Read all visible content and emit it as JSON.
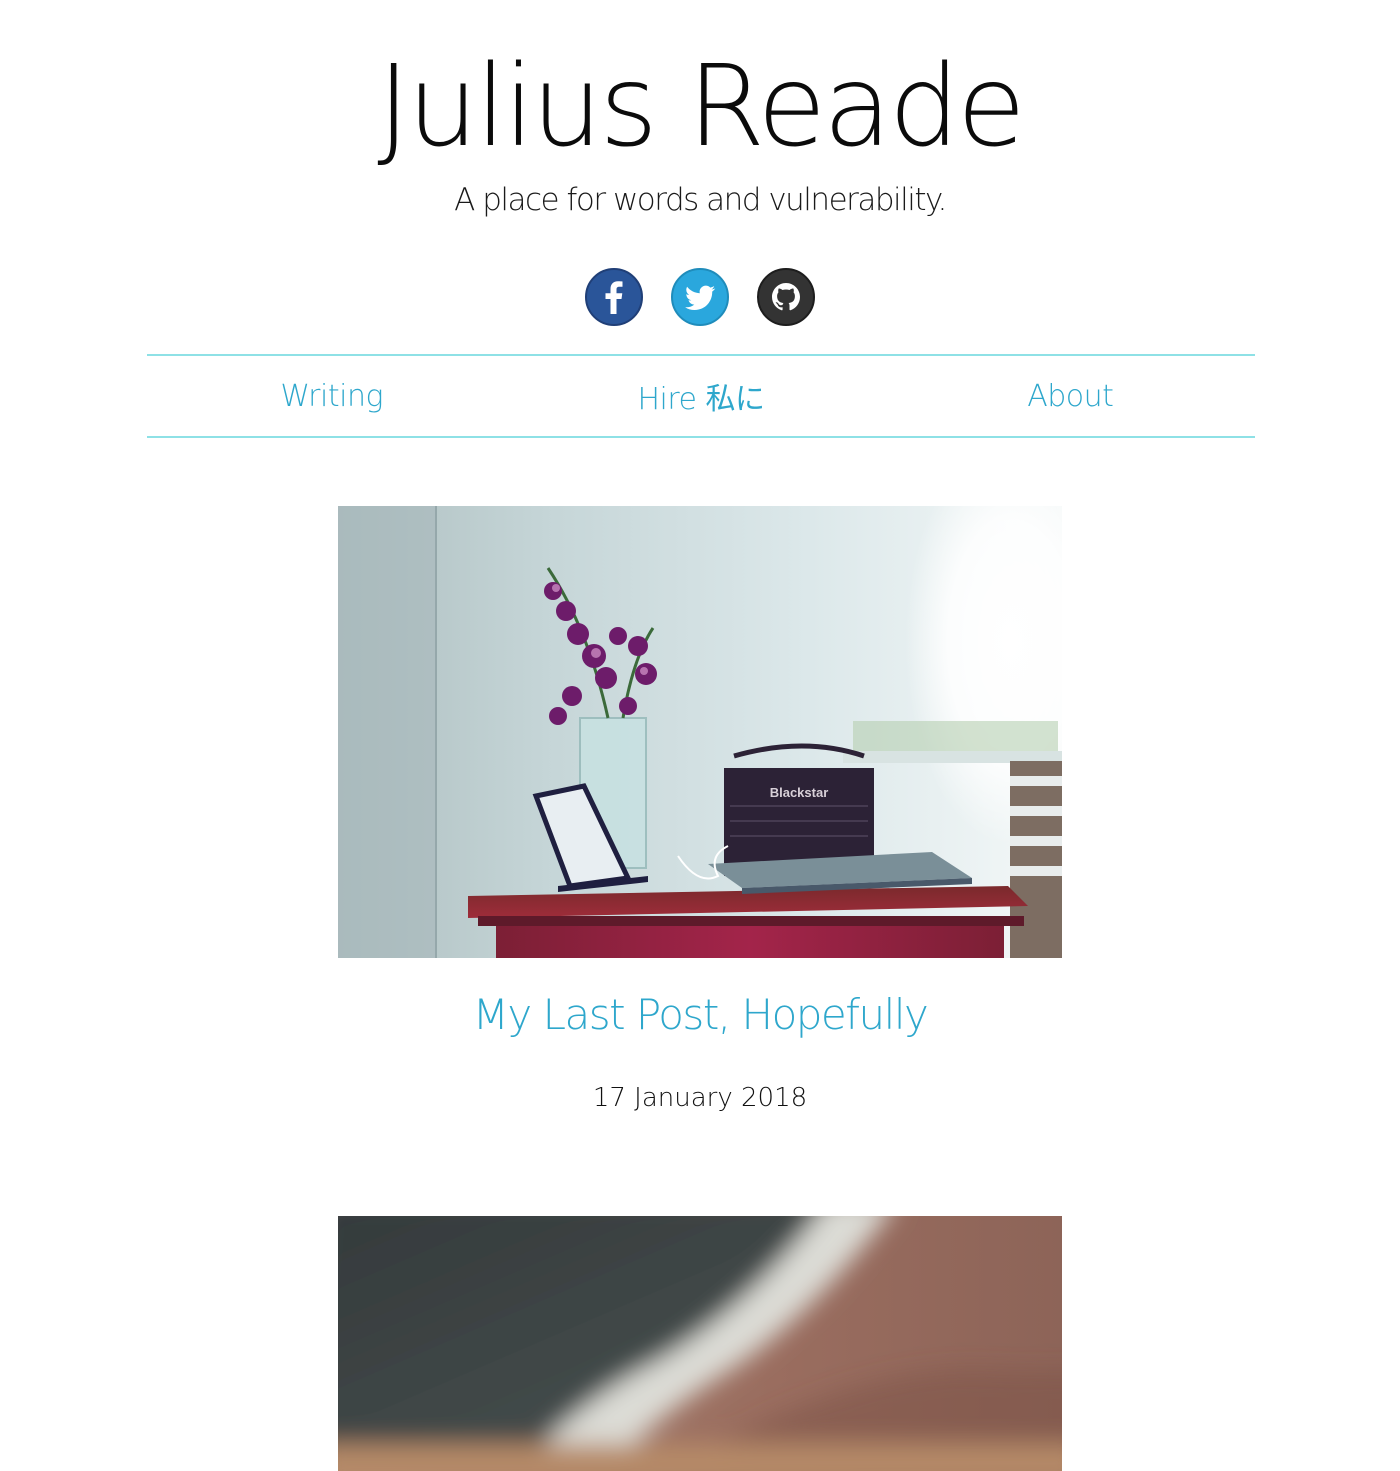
{
  "header": {
    "title": "Julius Reade",
    "tagline": "A place for words and vulnerability."
  },
  "social": [
    {
      "name": "facebook",
      "icon": "facebook-icon",
      "color": "#2a5599"
    },
    {
      "name": "twitter",
      "icon": "twitter-icon",
      "color": "#2aa7dd"
    },
    {
      "name": "github",
      "icon": "github-icon",
      "color": "#333333"
    }
  ],
  "nav": {
    "items": [
      {
        "label": "Writing"
      },
      {
        "label": "Hire 私に"
      },
      {
        "label": "About"
      }
    ],
    "accent_color": "#2ea7cc",
    "border_color": "#8ee1e6"
  },
  "posts": [
    {
      "title": "My Last Post, Hopefully",
      "date": "17 January 2018",
      "image": "desk-with-orchids-amp-laptop-photo"
    },
    {
      "image": "blurred-close-up-photo"
    }
  ]
}
